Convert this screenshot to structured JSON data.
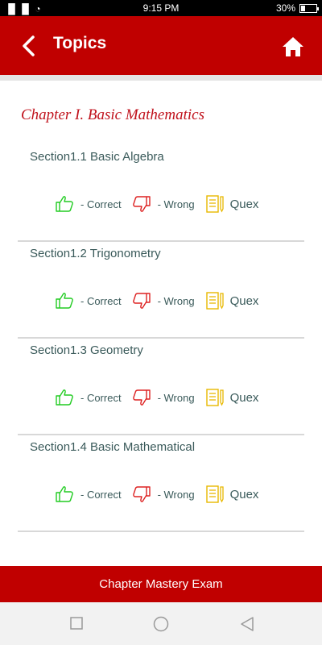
{
  "status_bar": {
    "signal": "▐▌▐▌ ◔",
    "time": "9:15 PM",
    "battery_pct": "30%",
    "battery_level": 0.3
  },
  "app_bar": {
    "title": "Topics",
    "back_icon": "chevron-left-icon",
    "home_icon": "home-icon"
  },
  "chapter": {
    "title": "Chapter I. Basic Mathematics"
  },
  "sections": [
    {
      "title": "Section1.1 Basic Algebra",
      "correct_label": "- Correct",
      "wrong_label": "- Wrong",
      "quex_label": "Quex"
    },
    {
      "title": "Section1.2 Trigonometry",
      "correct_label": "- Correct",
      "wrong_label": "- Wrong",
      "quex_label": "Quex"
    },
    {
      "title": "Section1.3 Geometry",
      "correct_label": "- Correct",
      "wrong_label": "- Wrong",
      "quex_label": "Quex"
    },
    {
      "title": "Section1.4 Basic Mathematical",
      "correct_label": "- Correct",
      "wrong_label": "- Wrong",
      "quex_label": "Quex"
    }
  ],
  "footer": {
    "button_label": "Chapter Mastery Exam"
  },
  "colors": {
    "primary": "#c00000",
    "chapter_title": "#c0121c",
    "correct_icon": "#22cc22",
    "wrong_icon": "#dd2222",
    "quex_icon": "#e8b800",
    "text": "#3a5a5a"
  }
}
